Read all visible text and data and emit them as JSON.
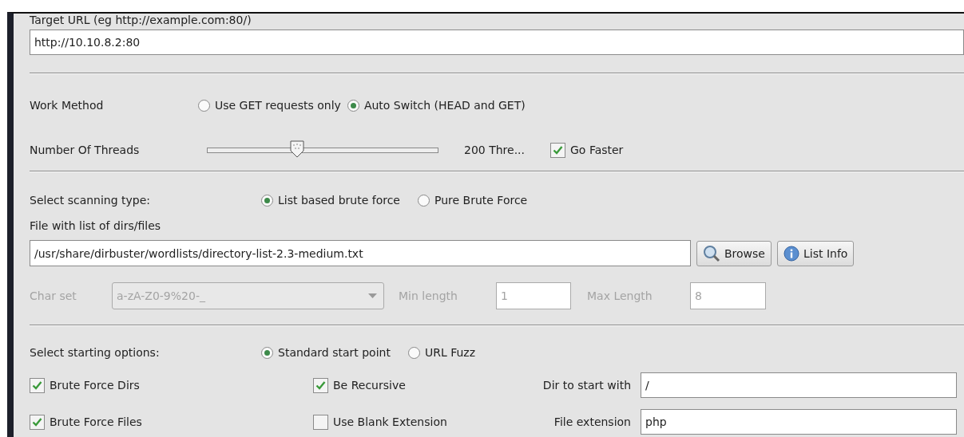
{
  "target_url": {
    "label": "Target URL (eg http://example.com:80/)",
    "value": "http://10.10.8.2:80"
  },
  "work_method": {
    "label": "Work Method",
    "options": [
      {
        "label": "Use GET requests only",
        "selected": false
      },
      {
        "label": "Auto Switch (HEAD and GET)",
        "selected": true
      }
    ]
  },
  "threads": {
    "label": "Number Of Threads",
    "level": 0.39,
    "reading": "200 Thre...",
    "go_faster": {
      "label": "Go Faster",
      "checked": true
    }
  },
  "scanning_type": {
    "label": "Select scanning type:",
    "options": [
      {
        "label": "List based brute force",
        "selected": true
      },
      {
        "label": "Pure Brute Force",
        "selected": false
      }
    ]
  },
  "file_list": {
    "label": "File with list of dirs/files",
    "value": "/usr/share/dirbuster/wordlists/directory-list-2.3-medium.txt",
    "buttons": [
      {
        "label": "Browse",
        "kind": "search"
      },
      {
        "label": "List Info",
        "kind": "info"
      }
    ]
  },
  "charset": {
    "disabled": true,
    "label": "Char set",
    "value": "a-zA-Z0-9%20-_",
    "min_label": "Min length",
    "min_value": "1",
    "max_label": "Max Length",
    "max_value": "8"
  },
  "start": {
    "label": "Select starting options:",
    "options": [
      {
        "label": "Standard start point",
        "selected": true
      },
      {
        "label": "URL Fuzz",
        "selected": false
      }
    ],
    "checks": [
      {
        "label": "Brute Force Dirs",
        "checked": true
      },
      {
        "label": "Brute Force Files",
        "checked": true
      },
      {
        "label": "Be Recursive",
        "checked": true
      },
      {
        "label": "Use Blank Extension",
        "checked": false
      }
    ],
    "fields": [
      {
        "label": "Dir to start with",
        "value": "/"
      },
      {
        "label": "File extension",
        "value": "php"
      }
    ]
  }
}
